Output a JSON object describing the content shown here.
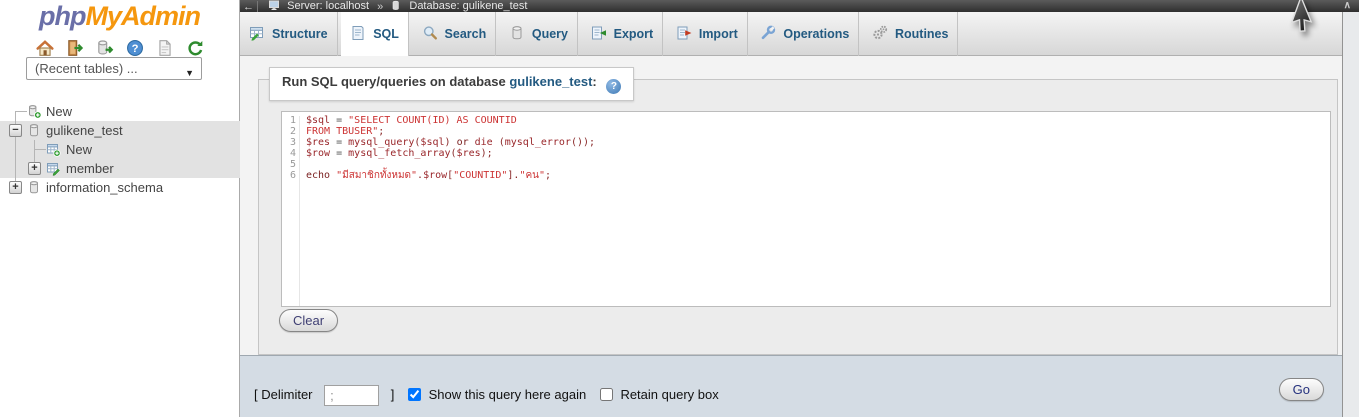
{
  "branding": {
    "logo_php": "php",
    "logo_myadmin": "MyAdmin"
  },
  "sidebar": {
    "recent_tables_placeholder": "(Recent tables) ...",
    "icons": [
      "home-icon",
      "logout-icon",
      "sql-window-icon",
      "documentation-icon",
      "mysql-docs-icon",
      "reload-icon"
    ],
    "tree": [
      {
        "label": "New",
        "icon": "database-new-icon",
        "expander": "",
        "level": 0
      },
      {
        "label": "gulikene_test",
        "icon": "database-icon",
        "expander": "−",
        "level": 0
      },
      {
        "label": "New",
        "icon": "table-new-icon",
        "expander": "",
        "level": 1
      },
      {
        "label": "member",
        "icon": "table-icon",
        "expander": "+",
        "level": 1
      },
      {
        "label": "information_schema",
        "icon": "database-icon",
        "expander": "+",
        "level": 0
      }
    ]
  },
  "breadcrumb": {
    "back": "←",
    "server": "Server: localhost",
    "separator": "»",
    "database": "Database: gulikene_test",
    "collapse": "∧"
  },
  "tabs": {
    "active": "SQL",
    "items": [
      {
        "label": "Structure",
        "icon": "structure-icon"
      },
      {
        "label": "SQL",
        "icon": "sql-icon"
      },
      {
        "label": "Search",
        "icon": "search-icon"
      },
      {
        "label": "Query",
        "icon": "query-icon"
      },
      {
        "label": "Export",
        "icon": "export-icon"
      },
      {
        "label": "Import",
        "icon": "import-icon"
      },
      {
        "label": "Operations",
        "icon": "operations-icon"
      },
      {
        "label": "Routines",
        "icon": "routines-icon"
      }
    ]
  },
  "query_panel": {
    "legend_prefix": "Run SQL query/queries on database ",
    "legend_db": "gulikene_test",
    "legend_colon": ":",
    "clear_button": "Clear",
    "editor": {
      "lines": [
        {
          "num": "1",
          "tokens": [
            [
              "var",
              "$sql"
            ],
            [
              "op",
              " = "
            ],
            [
              "str",
              "\"SELECT COUNT(ID) AS COUNTID"
            ]
          ]
        },
        {
          "num": "2",
          "tokens": [
            [
              "str",
              "FROM TBUSER\""
            ],
            [
              "pun",
              ";"
            ]
          ]
        },
        {
          "num": "3",
          "tokens": [
            [
              "var",
              "$res"
            ],
            [
              "op",
              " = "
            ],
            [
              "fn",
              "mysql_query"
            ],
            [
              "pun",
              "("
            ],
            [
              "var",
              "$sql"
            ],
            [
              "pun",
              ")"
            ],
            [
              "kw",
              " or "
            ],
            [
              "fn",
              "die"
            ],
            [
              "pun",
              " ("
            ],
            [
              "fn",
              "mysql_error"
            ],
            [
              "pun",
              "());"
            ]
          ]
        },
        {
          "num": "4",
          "tokens": [
            [
              "var",
              "$row"
            ],
            [
              "op",
              " = "
            ],
            [
              "fn",
              "mysql_fetch_array"
            ],
            [
              "pun",
              "("
            ],
            [
              "var",
              "$res"
            ],
            [
              "pun",
              ");"
            ]
          ]
        },
        {
          "num": "5",
          "tokens": []
        },
        {
          "num": "6",
          "tokens": [
            [
              "kw",
              "echo "
            ],
            [
              "str",
              "\"มีสมาชิกทั้งหมด\""
            ],
            [
              "pun",
              "."
            ],
            [
              "var",
              "$row"
            ],
            [
              "pun",
              "["
            ],
            [
              "str",
              "\"COUNTID\""
            ],
            [
              "pun",
              "]."
            ],
            [
              "str",
              "\"คน\""
            ],
            [
              "pun",
              ";"
            ]
          ]
        }
      ]
    }
  },
  "footer": {
    "delimiter_label": "[ Delimiter",
    "delimiter_value": ";",
    "bracket_close": "]",
    "show_query_label": "Show this query here again",
    "show_query_checked": true,
    "retain_label": "Retain query box",
    "retain_checked": false,
    "go_button": "Go"
  },
  "colors": {
    "logo_blue": "#6a6fa8",
    "logo_orange": "#f5970e",
    "tab_text": "#235a81",
    "topbar_bg": "#3f3f3f",
    "footer_bg": "#d4dce4",
    "code_string": "#cc3333",
    "code_variable": "#99262a"
  }
}
